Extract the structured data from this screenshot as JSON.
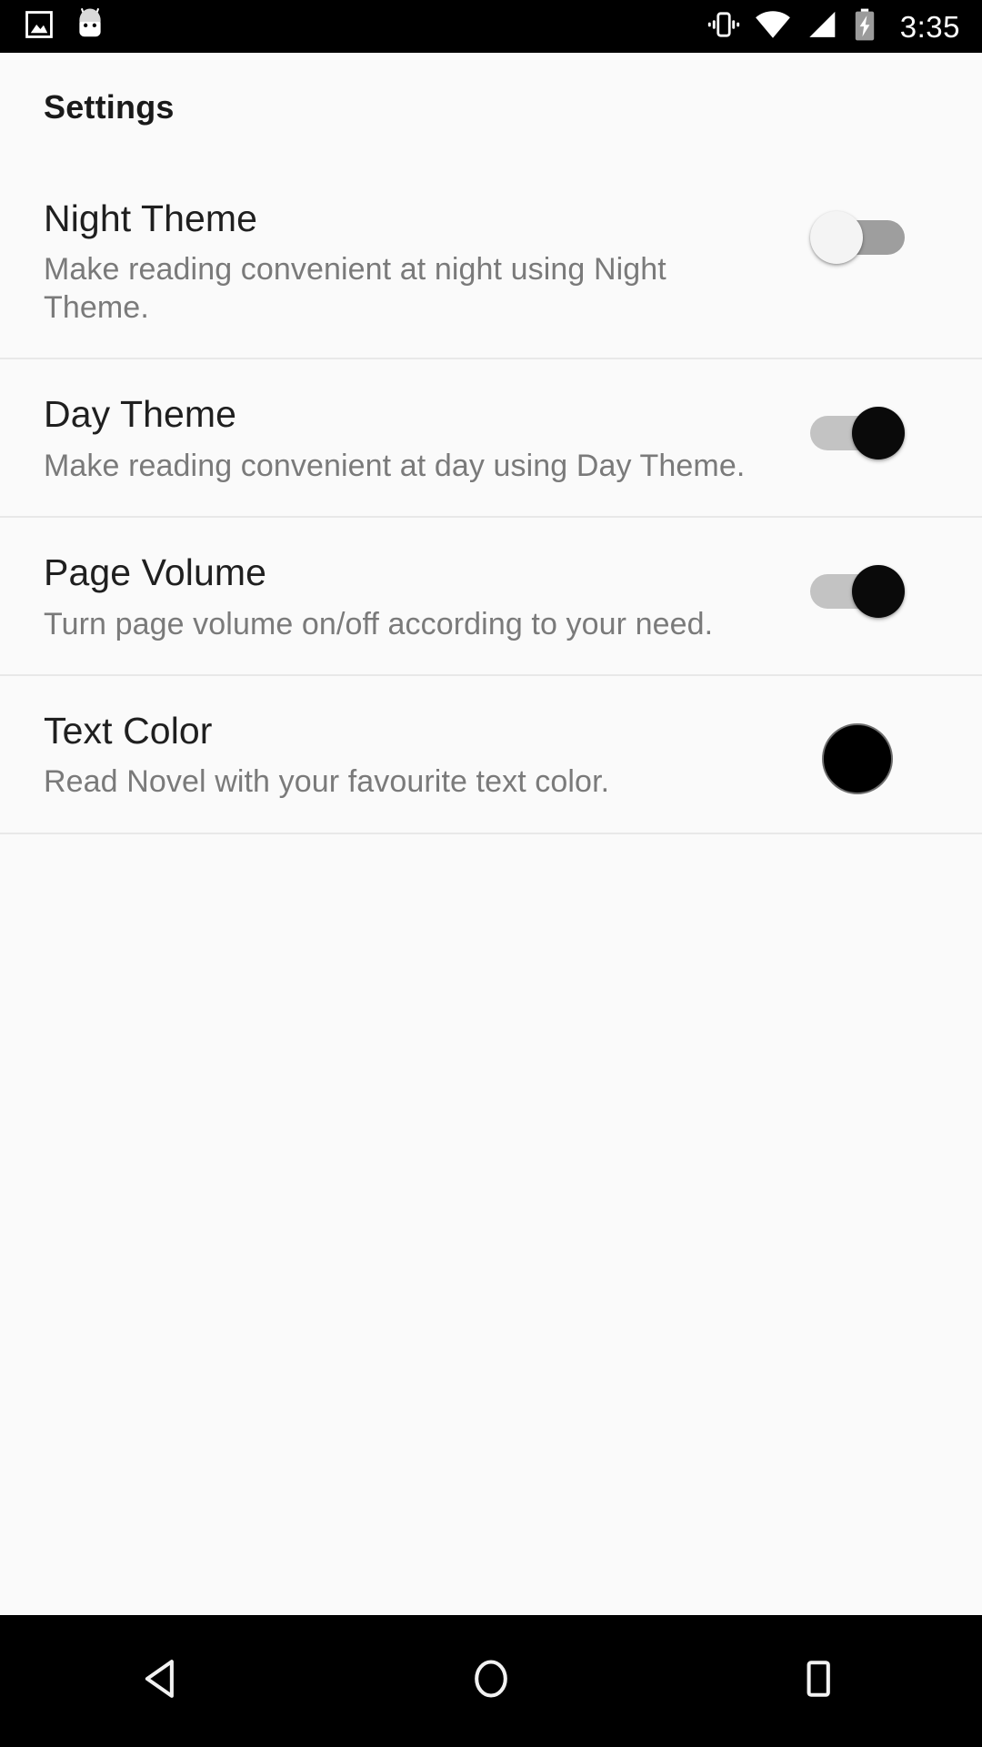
{
  "status_bar": {
    "background": "#000000",
    "left_icons": [
      {
        "name": "gallery-icon",
        "label": "Gallery"
      },
      {
        "name": "android-head-icon",
        "label": "Android System"
      }
    ],
    "right_icons": [
      {
        "name": "vibrate-icon",
        "label": "Vibrate"
      },
      {
        "name": "wifi-icon",
        "label": "Wi-Fi full"
      },
      {
        "name": "cellular-signal-icon",
        "label": "Signal full"
      },
      {
        "name": "battery-charging-icon",
        "label": "Battery charging"
      }
    ],
    "time": "3:35"
  },
  "page": {
    "title": "Settings",
    "background": "#fafafa",
    "title_color": "#1a1a1a"
  },
  "settings": {
    "rows": [
      {
        "key": "night-theme",
        "title": "Night Theme",
        "description": "Make reading convenient at night using Night Theme.",
        "control": "switch",
        "state": "off",
        "state_label": "Off"
      },
      {
        "key": "day-theme",
        "title": "Day Theme",
        "description": "Make reading convenient at day using Day Theme.",
        "control": "switch",
        "state": "on",
        "state_label": "On"
      },
      {
        "key": "page-volume",
        "title": "Page Volume",
        "description": "Turn page volume on/off according to your need.",
        "control": "switch",
        "state": "on",
        "state_label": "On"
      },
      {
        "key": "text-color",
        "title": "Text Color",
        "description": "Read Novel with your favourite text color.",
        "control": "color-swatch",
        "state": "#000000",
        "state_label": "Black"
      }
    ],
    "colors": {
      "title": "#1f1f1f",
      "description": "#7a7a7a",
      "divider": "#e8e8e8",
      "switch_on_thumb": "#0a0a0a",
      "switch_on_track": "#c3c3c3",
      "switch_off_thumb": "#f4f4f4",
      "switch_off_track": "#9e9e9e"
    }
  },
  "nav_bar": {
    "background": "#000000",
    "buttons": [
      {
        "name": "back-icon",
        "label": "Back"
      },
      {
        "name": "home-icon",
        "label": "Home"
      },
      {
        "name": "recents-icon",
        "label": "Recents"
      }
    ]
  }
}
